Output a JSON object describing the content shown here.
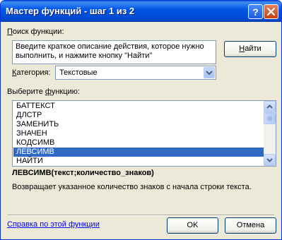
{
  "window": {
    "title": "Мастер функций - шаг 1 из 2",
    "help_icon": "question-mark",
    "close_icon": "close-x"
  },
  "search": {
    "label_prefix": "",
    "label_hotkey": "П",
    "label_rest": "оиск функции:",
    "placeholder_line1": "Введите краткое описание действия, которое нужно",
    "placeholder_line2": "выполнить, и нажмите кнопку \"Найти\"",
    "find_button_hotkey": "Н",
    "find_button_rest": "айти"
  },
  "category": {
    "label_hotkey": "К",
    "label_rest": "атегория:",
    "selected": "Текстовые"
  },
  "function_list": {
    "label_prefix": "Выберите ",
    "label_hotkey": "ф",
    "label_rest": "ункцию:",
    "items": [
      "БАТТЕКСТ",
      "ДЛСТР",
      "ЗАМЕНИТЬ",
      "ЗНАЧЕН",
      "КОДСИМВ",
      "ЛЕВСИМВ",
      "НАЙТИ"
    ],
    "selected_index": 5
  },
  "details": {
    "signature": "ЛЕВСИМВ(текст;количество_знаков)",
    "description": "Возвращает указанное количество знаков с начала строки текста."
  },
  "footer": {
    "help_link": "Справка по этой функции",
    "ok_label": "OK",
    "cancel_label": "Отмена"
  },
  "colors": {
    "title_bar": "#0058e6",
    "selection": "#316ac5",
    "link": "#0000ff",
    "dialog_bg": "#ece9d8"
  }
}
